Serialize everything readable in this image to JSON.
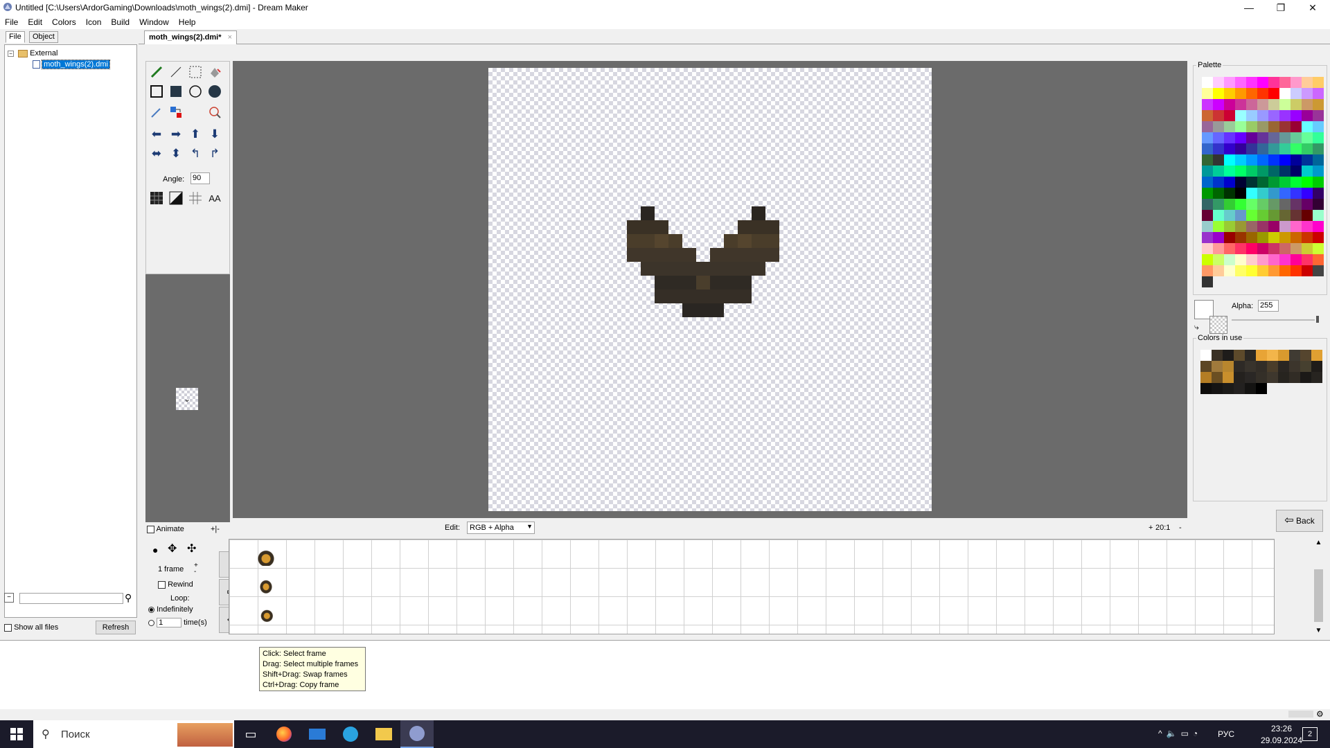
{
  "window": {
    "title": "Untitled [C:\\Users\\ArdorGaming\\Downloads\\moth_wings(2).dmi] - Dream Maker",
    "minimize": "—",
    "maximize": "❐",
    "close": "✕"
  },
  "menu": [
    "File",
    "Edit",
    "Colors",
    "Icon",
    "Build",
    "Window",
    "Help"
  ],
  "left_panel": {
    "tabs": [
      "File",
      "Object"
    ],
    "tree_root": "External",
    "tree_file": "moth_wings(2).dmi",
    "show_all_files_label": "Show all files",
    "refresh_label": "Refresh",
    "search_value": ""
  },
  "doc_tab": {
    "label": "moth_wings(2).dmi*",
    "close": "×"
  },
  "tools": {
    "angle_label": "Angle:",
    "angle_value": "90",
    "aa_label": "AA",
    "icons": [
      "pencil-icon",
      "line-icon",
      "select-icon",
      "eraser-icon",
      "rect-outline-icon",
      "rect-filled-icon",
      "ellipse-outline-icon",
      "ellipse-filled-icon",
      "eyedropper-icon",
      "color-replace-icon",
      "",
      "magnify-icon",
      "arrow-left-icon",
      "arrow-right-icon",
      "arrow-up-icon",
      "arrow-down-icon",
      "flip-horizontal-icon",
      "flip-vertical-icon",
      "rotate-left-icon",
      "rotate-right-icon",
      "grid-icon",
      "invert-icon",
      "gridlines-icon",
      "antialias-icon"
    ]
  },
  "palette": {
    "label": "Palette",
    "alpha_label": "Alpha:",
    "alpha_value": "255",
    "colors_in_use_label": "Colors in use",
    "back_label": "Back",
    "colors": [
      "#ffffff",
      "#ffccff",
      "#ff99ff",
      "#ff66ff",
      "#ff33ff",
      "#ff00ff",
      "#ff3399",
      "#ff6699",
      "#ff99cc",
      "#ffcc99",
      "#ffcc66",
      "#ffff99",
      "#ffff00",
      "#ffcc00",
      "#ff9900",
      "#ff6600",
      "#ff3300",
      "#ff0000",
      "#ffffff",
      "#ccccff",
      "#cc99ff",
      "#cc66ff",
      "#cc33ff",
      "#cc00ff",
      "#cc0099",
      "#cc3399",
      "#cc6699",
      "#cc9999",
      "#cccc99",
      "#ccff99",
      "#cccc66",
      "#cc9966",
      "#cc9933",
      "#cc6633",
      "#cc3333",
      "#cc0033",
      "#99ffff",
      "#99ccff",
      "#9999ff",
      "#9966ff",
      "#9933ff",
      "#9900ff",
      "#990099",
      "#993399",
      "#996699",
      "#999999",
      "#99cc99",
      "#99ff99",
      "#99cc66",
      "#999966",
      "#996633",
      "#993333",
      "#990033",
      "#66ffff",
      "#66ccff",
      "#6699ff",
      "#6666ff",
      "#6633ff",
      "#6600ff",
      "#660099",
      "#663399",
      "#666699",
      "#669999",
      "#66cc99",
      "#66ff99",
      "#33ff99",
      "#3366cc",
      "#3333cc",
      "#3300cc",
      "#330099",
      "#333399",
      "#336699",
      "#339999",
      "#33cc99",
      "#33ff66",
      "#33cc66",
      "#339966",
      "#336633",
      "#333333",
      "#00ffff",
      "#00ccff",
      "#0099ff",
      "#0066ff",
      "#0033ff",
      "#0000ff",
      "#000099",
      "#003399",
      "#006699",
      "#009999",
      "#00cc99",
      "#00ff99",
      "#00ff66",
      "#00cc66",
      "#009966",
      "#006666",
      "#003366",
      "#000066",
      "#00cccc",
      "#0099cc",
      "#0066cc",
      "#0033cc",
      "#0000cc",
      "#000033",
      "#003333",
      "#006633",
      "#009933",
      "#00cc33",
      "#00ff33",
      "#00ff00",
      "#00cc00",
      "#009900",
      "#006600",
      "#003300",
      "#000000",
      "#33ffff",
      "#33cccc",
      "#3399cc",
      "#3366ff",
      "#3333ff",
      "#3300ff",
      "#330066",
      "#336666",
      "#339966",
      "#33cc33",
      "#33ff33",
      "#66ff66",
      "#66cc66",
      "#669966",
      "#666666",
      "#663366",
      "#660066",
      "#330033",
      "#660033",
      "#66ffcc",
      "#66cccc",
      "#6699cc",
      "#66ff33",
      "#66cc33",
      "#669933",
      "#666633",
      "#663333",
      "#660000",
      "#99ffcc",
      "#99cccc",
      "#99ff33",
      "#99cc33",
      "#999933",
      "#996666",
      "#993366",
      "#990066",
      "#cc99cc",
      "#ff66cc",
      "#ff33cc",
      "#ff00cc",
      "#9933cc",
      "#9900cc",
      "#990000",
      "#993300",
      "#996600",
      "#999900",
      "#cccc00",
      "#cc9900",
      "#cc6600",
      "#cc3300",
      "#cc0000",
      "#ffcccc",
      "#ff9999",
      "#ff6666",
      "#ff3366",
      "#ff0066",
      "#cc0066",
      "#cc3366",
      "#cc6666",
      "#cc9966",
      "#cccc33",
      "#ccff33",
      "#ccff00",
      "#ccff66",
      "#ccffcc",
      "#ffffcc",
      "#ffcccc",
      "#ff99cc",
      "#ff66cc",
      "#ff33cc",
      "#ff0099",
      "#ff3366",
      "#ff6633",
      "#ff9966",
      "#ffcc99",
      "#ffffcc",
      "#ffff66",
      "#ffff33",
      "#ffcc33",
      "#ff9933",
      "#ff6600",
      "#ff3300",
      "#cc0000",
      "#444444",
      "#333333"
    ],
    "in_use": [
      "#ffffff",
      "#3a3125",
      "#1e1c1a",
      "#5d4a2b",
      "#2b2824",
      "#e8a436",
      "#f3b54a",
      "#d99a2e",
      "#403b33",
      "#55452e",
      "#e0a032",
      "#5c4624",
      "#a07a3c",
      "#b8862e",
      "#2e2a26",
      "#38332c",
      "#322d27",
      "#4a3d2a",
      "#2a2622",
      "#3c352c",
      "#46402f",
      "#1f1c19",
      "#b47d24",
      "#6b4f22",
      "#c98f2c",
      "#24211e",
      "#2a2725",
      "#342f28",
      "#3e372d",
      "#27241f",
      "#312c25",
      "#1b1917",
      "#272420",
      "#0e0d0c",
      "#151413",
      "#1c1b19",
      "#232120",
      "#141312",
      "#000000"
    ]
  },
  "edit_row": {
    "edit_label": "Edit:",
    "edit_value": "RGB + Alpha",
    "zoom_plus": "+",
    "zoom_value": "20:1",
    "zoom_minus": "-"
  },
  "animation": {
    "animate_label": "Animate",
    "frames_value": "1 frame",
    "rewind_label": "Rewind",
    "loop_label": "Loop:",
    "indefinitely_label": "Indefinitely",
    "times_value": "1",
    "times_label": "time(s)"
  },
  "tooltip": [
    "Click: Select frame",
    "Drag: Select multiple frames",
    "Shift+Drag: Swap frames",
    "Ctrl+Drag: Copy frame"
  ],
  "taskbar": {
    "search_placeholder": "Поиск",
    "lang": "РУС",
    "time": "23:26",
    "date": "29.09.2024",
    "notification_count": "2"
  }
}
